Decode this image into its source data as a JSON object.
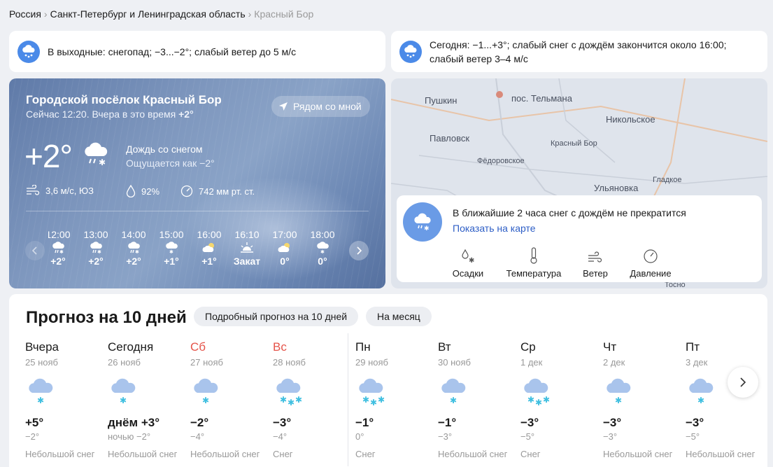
{
  "breadcrumbs": [
    "Россия",
    "Санкт-Петербург и Ленинградская область",
    "Красный Бор"
  ],
  "alerts": {
    "weekend": "В выходные: снегопад; −3...−2°; слабый ветер до 5 м/с",
    "today_line1": "Сегодня: −1...+3°; слабый снег с дождём закончится около 16:00;",
    "today_line2": "слабый ветер 3–4 м/с"
  },
  "current": {
    "place": "Городской посёлок Красный Бор",
    "now_prefix": "Сейчас 12:20. Вчера в это время ",
    "yesterday_temp": "+2°",
    "near_me": "Рядом со мной",
    "temp": "+2°",
    "condition": "Дождь со снегом",
    "feels_like": "Ощущается как −2°",
    "wind": "3,6 м/с, ЮЗ",
    "humidity": "92%",
    "pressure": "742 мм рт. ст.",
    "icon": "rain-snow-icon"
  },
  "hourly": [
    {
      "time": "12:00",
      "temp": "+2°",
      "icon": "rain-snow-icon"
    },
    {
      "time": "13:00",
      "temp": "+2°",
      "icon": "rain-snow-icon"
    },
    {
      "time": "14:00",
      "temp": "+2°",
      "icon": "rain-snow-icon"
    },
    {
      "time": "15:00",
      "temp": "+1°",
      "icon": "snow-icon"
    },
    {
      "time": "16:00",
      "temp": "+1°",
      "icon": "partly-cloudy-icon"
    },
    {
      "time": "16:10",
      "temp": "Закат",
      "icon": "sunset-icon"
    },
    {
      "time": "17:00",
      "temp": "0°",
      "icon": "partly-cloudy-icon"
    },
    {
      "time": "18:00",
      "temp": "0°",
      "icon": "snow-icon"
    }
  ],
  "map": {
    "labels": [
      "Пушкин",
      "пос. Тельмана",
      "Никольское",
      "Павловск",
      "Красный Бор",
      "Фёдоровское",
      "Гладкое",
      "Ульяновка",
      "Тосно"
    ],
    "nowcast": "В ближайшие 2 часа снег с дождём не прекратится",
    "show_on_map": "Показать на карте",
    "layers": [
      "Осадки",
      "Температура",
      "Ветер",
      "Давление"
    ]
  },
  "forecast": {
    "title": "Прогноз на 10 дней",
    "detailed": "Подробный прогноз на 10 дней",
    "month": "На месяц",
    "days": [
      {
        "name": "Вчера",
        "date": "25 нояб",
        "temp": "+5°",
        "night": "−2°",
        "cond": "Небольшой снег",
        "weekend": false,
        "heavy": false
      },
      {
        "name": "Сегодня",
        "date": "26 нояб",
        "temp": "днём +3°",
        "night": "ночью −2°",
        "cond": "Небольшой снег",
        "weekend": false,
        "heavy": false
      },
      {
        "name": "Сб",
        "date": "27 нояб",
        "temp": "−2°",
        "night": "−4°",
        "cond": "Небольшой снег",
        "weekend": true,
        "heavy": false
      },
      {
        "name": "Вс",
        "date": "28 нояб",
        "temp": "−3°",
        "night": "−4°",
        "cond": "Снег",
        "weekend": true,
        "heavy": true
      },
      {
        "name": "Пн",
        "date": "29 нояб",
        "temp": "−1°",
        "night": "0°",
        "cond": "Снег",
        "weekend": false,
        "heavy": true
      },
      {
        "name": "Вт",
        "date": "30 нояб",
        "temp": "−1°",
        "night": "−3°",
        "cond": "Небольшой снег",
        "weekend": false,
        "heavy": false
      },
      {
        "name": "Ср",
        "date": "1 дек",
        "temp": "−3°",
        "night": "−5°",
        "cond": "Снег",
        "weekend": false,
        "heavy": true
      },
      {
        "name": "Чт",
        "date": "2 дек",
        "temp": "−3°",
        "night": "−3°",
        "cond": "Небольшой снег",
        "weekend": false,
        "heavy": false
      },
      {
        "name": "Пт",
        "date": "3 дек",
        "temp": "−3°",
        "night": "−5°",
        "cond": "Небольшой снег",
        "weekend": false,
        "heavy": false
      }
    ]
  },
  "colors": {
    "accent": "#4b8ae8",
    "link": "#2d5ec6",
    "weekend": "#e5544a",
    "snow": "#3fbfe0"
  }
}
